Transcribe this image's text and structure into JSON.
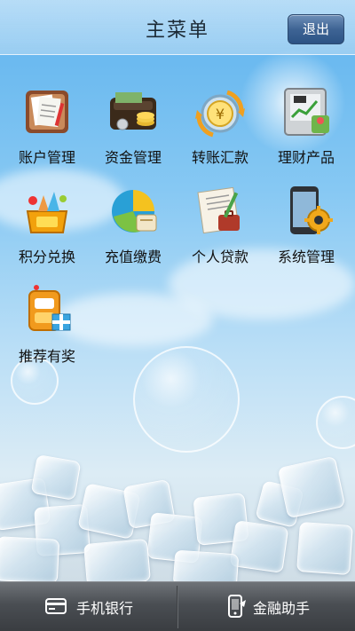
{
  "header": {
    "title": "主菜单",
    "logout_label": "退出"
  },
  "menu": {
    "items": [
      {
        "label": "账户管理",
        "icon": "account-management-icon"
      },
      {
        "label": "资金管理",
        "icon": "fund-management-icon"
      },
      {
        "label": "转账汇款",
        "icon": "transfer-icon"
      },
      {
        "label": "理财产品",
        "icon": "wealth-products-icon"
      },
      {
        "label": "积分兑换",
        "icon": "points-exchange-icon"
      },
      {
        "label": "充值缴费",
        "icon": "recharge-payment-icon"
      },
      {
        "label": "个人贷款",
        "icon": "personal-loan-icon"
      },
      {
        "label": "系统管理",
        "icon": "system-settings-icon"
      },
      {
        "label": "推荐有奖",
        "icon": "referral-reward-icon"
      }
    ]
  },
  "tabbar": {
    "tabs": [
      {
        "label": "手机银行",
        "icon": "bank-card-icon"
      },
      {
        "label": "金融助手",
        "icon": "finance-assistant-icon"
      }
    ]
  }
}
